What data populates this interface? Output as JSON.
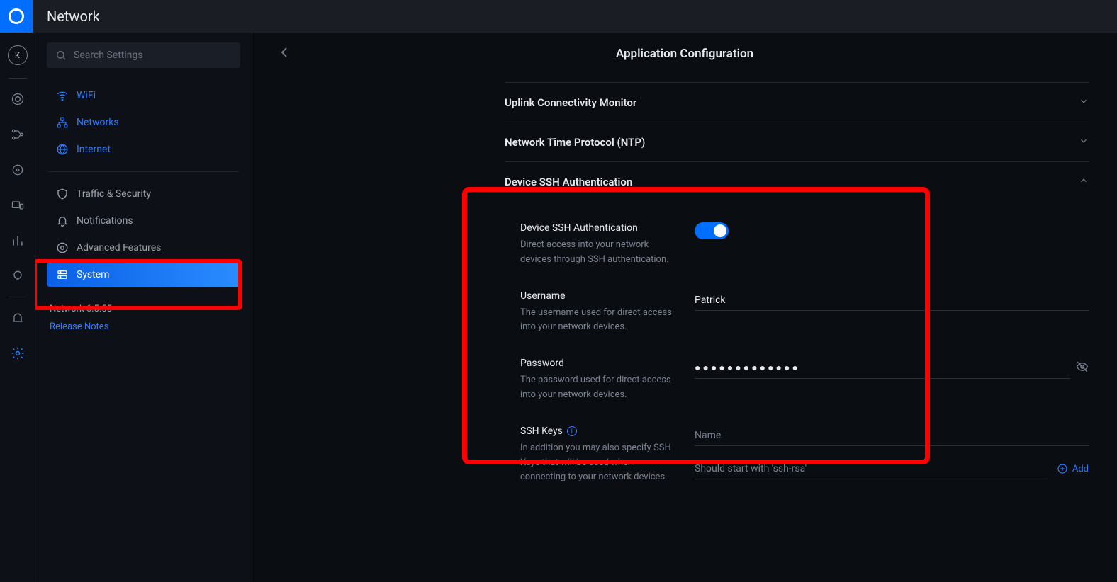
{
  "topbar": {
    "title": "Network"
  },
  "search": {
    "placeholder": "Search Settings"
  },
  "sidebar": {
    "primary": [
      {
        "label": "WiFi"
      },
      {
        "label": "Networks"
      },
      {
        "label": "Internet"
      }
    ],
    "secondary": [
      {
        "label": "Traffic & Security"
      },
      {
        "label": "Notifications"
      },
      {
        "label": "Advanced Features"
      },
      {
        "label": "System"
      }
    ],
    "version": "Network 6.5.55",
    "release_notes": "Release Notes"
  },
  "main": {
    "title": "Application Configuration",
    "sections": {
      "uplink": "Uplink Connectivity Monitor",
      "ntp": "Network Time Protocol (NTP)",
      "ssh": "Device SSH Authentication"
    },
    "ssh": {
      "toggle_label": "Device SSH Authentication",
      "toggle_desc": "Direct access into your network devices through SSH authentication.",
      "username_label": "Username",
      "username_desc": "The username used for direct access into your network devices.",
      "username_value": "Patrick",
      "password_label": "Password",
      "password_desc": "The password used for direct access into your network devices.",
      "password_masked": "●●●●●●●●●●●●●",
      "sshkeys_label": "SSH Keys",
      "sshkeys_desc": "In addition you may also specify SSH Keys that will be used when connecting to your network devices.",
      "sshkeys_name_placeholder": "Name",
      "sshkeys_key_placeholder": "Should start with 'ssh-rsa'",
      "add_label": "Add"
    }
  }
}
